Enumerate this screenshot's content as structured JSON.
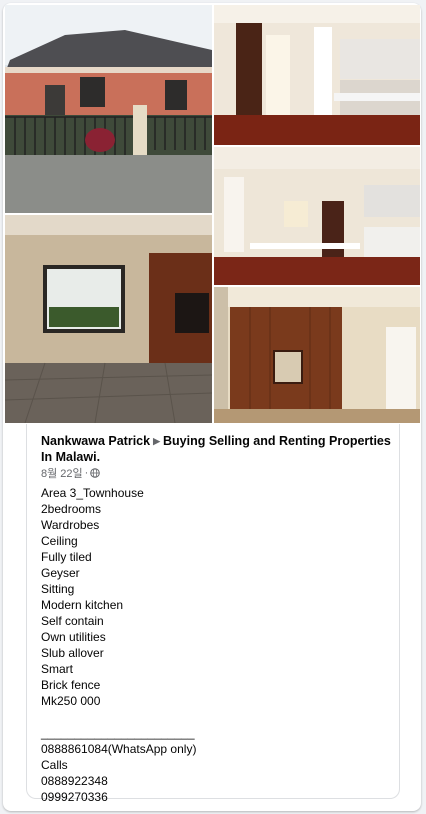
{
  "post": {
    "author": "Nankwawa Patrick",
    "group": "Buying Selling and Renting Properties In Malawi.",
    "date": "8월 22일",
    "lines": [
      "Area 3_Townhouse",
      "2bedrooms",
      "Wardrobes",
      "Ceiling",
      "Fully tiled",
      "Geyser",
      "Sitting",
      "Modern kitchen",
      "Self contain",
      "Own utilities",
      "Slub allover",
      "Smart",
      "Brick fence",
      "Mk250 000",
      "",
      "_______________________",
      "0888861084(WhatsApp only)",
      "Calls",
      "0888922348",
      "0999270336"
    ]
  },
  "icons": {
    "separator": "triangle-right-icon",
    "privacy": "globe-icon"
  },
  "colors": {
    "text": "#050505",
    "secondary": "#65676b",
    "background": "#f0f2f5"
  }
}
